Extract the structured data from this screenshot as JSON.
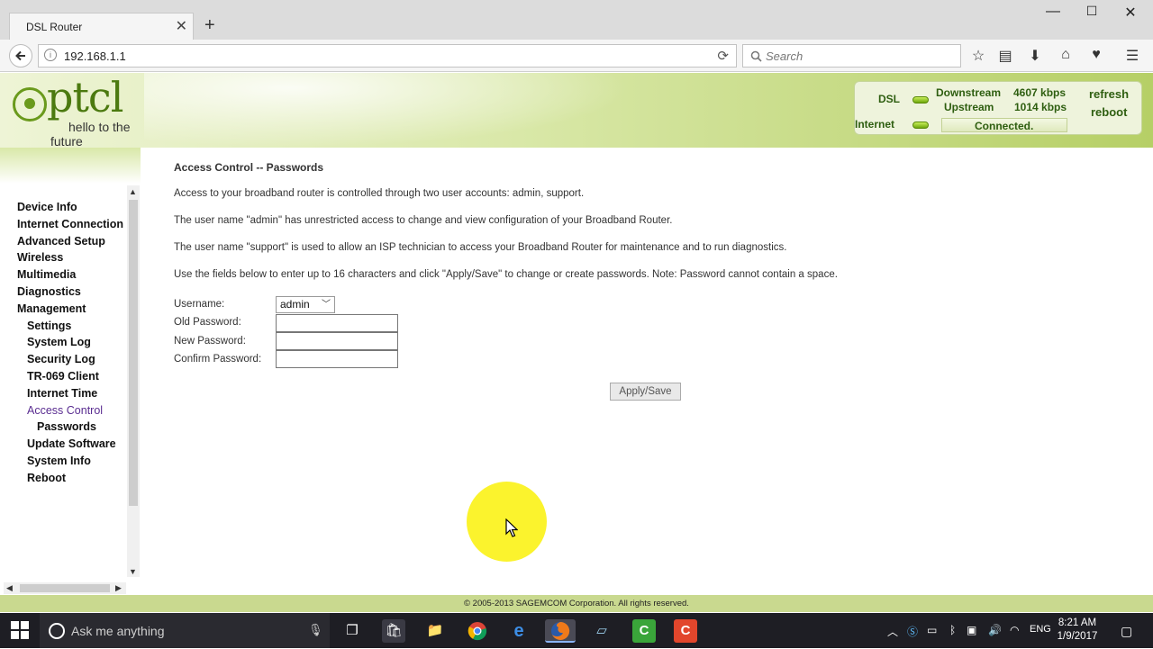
{
  "browser": {
    "tab_title": "DSL Router",
    "tab_close": "✕",
    "new_tab": "+",
    "url": "192.168.1.1",
    "search_placeholder": "Search",
    "window_controls": [
      "—",
      "☐",
      "✕"
    ]
  },
  "router": {
    "logo": {
      "word": "ptcl",
      "tagline_1": "hello to the",
      "tagline_2": "future"
    },
    "status": {
      "dsl_label": "DSL",
      "downstream_label": "Downstream",
      "downstream_value": "4607 kbps",
      "upstream_label": "Upstream",
      "upstream_value": "1014 kbps",
      "internet_label": "Internet",
      "connection_state": "Connected.",
      "refresh_link": "refresh",
      "reboot_link": "reboot"
    },
    "nav": [
      {
        "label": "Device Info"
      },
      {
        "label": "Internet Connection"
      },
      {
        "label": "Advanced Setup"
      },
      {
        "label": "Wireless"
      },
      {
        "label": "Multimedia"
      },
      {
        "label": "Diagnostics"
      },
      {
        "label": "Management"
      },
      {
        "label": "Settings"
      },
      {
        "label": "System Log"
      },
      {
        "label": "Security Log"
      },
      {
        "label": "TR-069 Client"
      },
      {
        "label": "Internet Time"
      },
      {
        "label": "Access Control"
      },
      {
        "label": "Passwords"
      },
      {
        "label": "Update Software"
      },
      {
        "label": "System Info"
      },
      {
        "label": "Reboot"
      }
    ],
    "content": {
      "title": "Access Control -- Passwords",
      "paragraphs": [
        "Access to your broadband router is controlled through two user accounts: admin, support.",
        "The user name \"admin\" has unrestricted access to change and view configuration of your Broadband Router.",
        "The user name \"support\" is used to allow an ISP technician to access your Broadband Router for maintenance and to run diagnostics.",
        "Use the fields below to enter up to 16 characters and click \"Apply/Save\" to change or create passwords. Note: Password cannot contain a space."
      ],
      "form": {
        "username_label": "Username:",
        "username_value": "admin",
        "old_password_label": "Old Password:",
        "new_password_label": "New Password:",
        "confirm_password_label": "Confirm Password:",
        "old_password_value": "",
        "new_password_value": "",
        "confirm_password_value": "",
        "apply_label": "Apply/Save"
      }
    },
    "footer": "© 2005-2013 SAGEMCOM Corporation. All rights reserved."
  },
  "taskbar": {
    "search_placeholder": "Ask me anything",
    "language": "ENG",
    "time": "8:21 AM",
    "date": "1/9/2017"
  },
  "colors": {
    "brand_green": "#4c7a10",
    "status_text": "#2e5e10",
    "active_nav": "#5a2d91",
    "cursor_highlight": "#fbf21b"
  }
}
